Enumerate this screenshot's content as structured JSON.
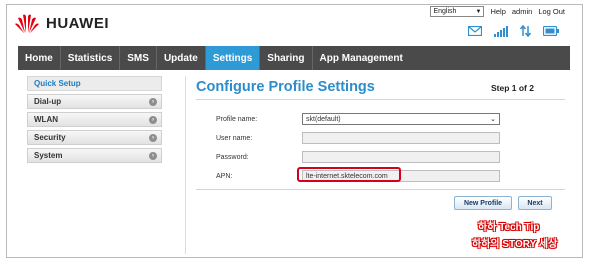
{
  "brand": {
    "logo_text": "HUAWEI",
    "logo_color": "#e60012"
  },
  "top_bar": {
    "language_selected": "English",
    "links": [
      "Help",
      "admin",
      "Log Out"
    ]
  },
  "status_icons": [
    "mail-icon",
    "signal-icon",
    "data-transfer-icon",
    "battery-icon"
  ],
  "nav": {
    "items": [
      "Home",
      "Statistics",
      "SMS",
      "Update",
      "Settings",
      "Sharing",
      "App Management"
    ],
    "active": "Settings",
    "active_color": "#2f9bd6",
    "bar_color": "#4a4a4a"
  },
  "sidebar": {
    "items": [
      "Quick Setup",
      "Dial-up",
      "WLAN",
      "Security",
      "System"
    ],
    "active": "Quick Setup"
  },
  "main": {
    "title": "Configure Profile Settings",
    "step": "Step 1 of 2",
    "fields": {
      "profile_name_label": "Profile name:",
      "profile_name_value": "skt(default)",
      "user_name_label": "User name:",
      "user_name_value": "",
      "password_label": "Password:",
      "password_value": "",
      "apn_label": "APN:",
      "apn_value": "lte-internet.sktelecom.com"
    },
    "buttons": {
      "new_profile": "New Profile",
      "next": "Next"
    }
  },
  "watermark": {
    "line1": "하하 Tech Tip",
    "line2": "하하의 STORY 세상"
  },
  "highlight_color": "#d6001c"
}
